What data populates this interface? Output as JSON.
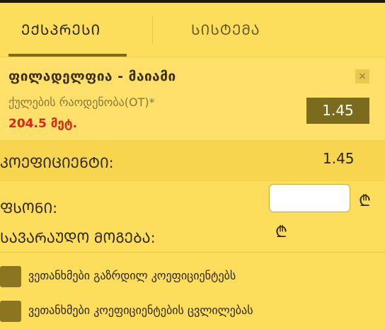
{
  "tabs": [
    {
      "label": "ᲔᲥᲡᲞᲠᲔᲡᲘ",
      "active": true
    },
    {
      "label": "ᲡᲘᲡᲢᲔᲛᲐ",
      "active": false
    }
  ],
  "bet": {
    "match": "ფილადელფია - მაიამი",
    "market": "ქულების რაოდენობა(OT)*",
    "amount": "204.5 მეტ.",
    "odd": "1.45",
    "close": "×"
  },
  "summary": {
    "coef_label": "ᲙᲝᲔᲤᲘᲪᲘᲔᲜᲢᲘ:",
    "coef_value": "1.45",
    "stake_label": "ᲤᲡᲝᲜᲘ:",
    "stake_value": "",
    "win_label": "ᲡᲐᲕᲐᲠᲐᲣᲓᲝ ᲛᲝᲒᲔᲑᲐ:",
    "currency": "₾"
  },
  "options": [
    {
      "label": "ვეთანხმები გაზრდილ კოეფიციენტებს"
    },
    {
      "label": "ვეთანხმები კოეფიციენტების ცვლილებას"
    }
  ],
  "colors": {
    "background": "#fddd5c",
    "odd_button": "#7b6b1e",
    "amount_text": "#d8261b",
    "checkbox": "#8b7520"
  }
}
